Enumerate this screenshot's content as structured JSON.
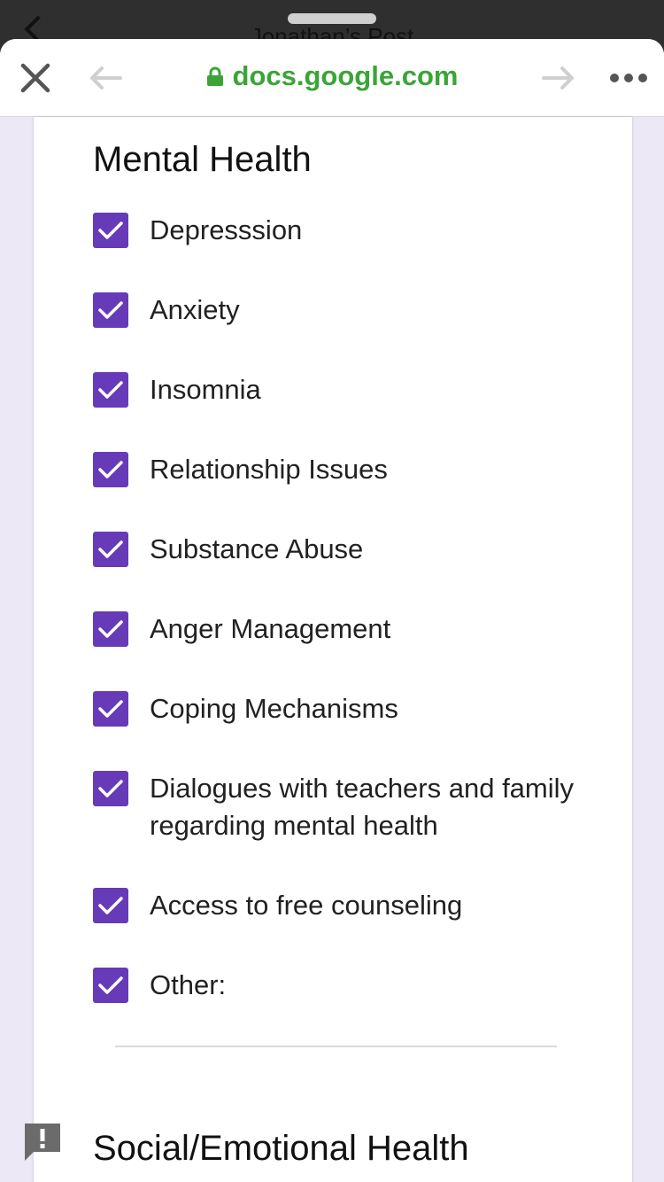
{
  "behind": {
    "title": "Jonathan’s Post"
  },
  "browser": {
    "url": "docs.google.com"
  },
  "form": {
    "section_title": "Mental Health",
    "options": [
      {
        "label": "Depresssion",
        "checked": true
      },
      {
        "label": "Anxiety",
        "checked": true
      },
      {
        "label": "Insomnia",
        "checked": true
      },
      {
        "label": "Relationship Issues",
        "checked": true
      },
      {
        "label": "Substance Abuse",
        "checked": true
      },
      {
        "label": "Anger Management",
        "checked": true
      },
      {
        "label": "Coping Mechanisms",
        "checked": true
      },
      {
        "label": "Dialogues with teachers and family regarding mental health",
        "checked": true
      },
      {
        "label": "Access to free counseling",
        "checked": true
      },
      {
        "label": "Other:",
        "checked": true
      }
    ],
    "next_section_title": "Social/Emotional Health"
  },
  "colors": {
    "checkbox": "#673ab7",
    "url_green": "#3aa536",
    "page_background": "#ece8f6"
  },
  "icons": [
    "back-chevron-icon",
    "more-dots-icon",
    "close-icon",
    "back-arrow-icon",
    "lock-icon",
    "forward-arrow-icon",
    "more-icon",
    "checkmark-icon",
    "feedback-icon"
  ]
}
